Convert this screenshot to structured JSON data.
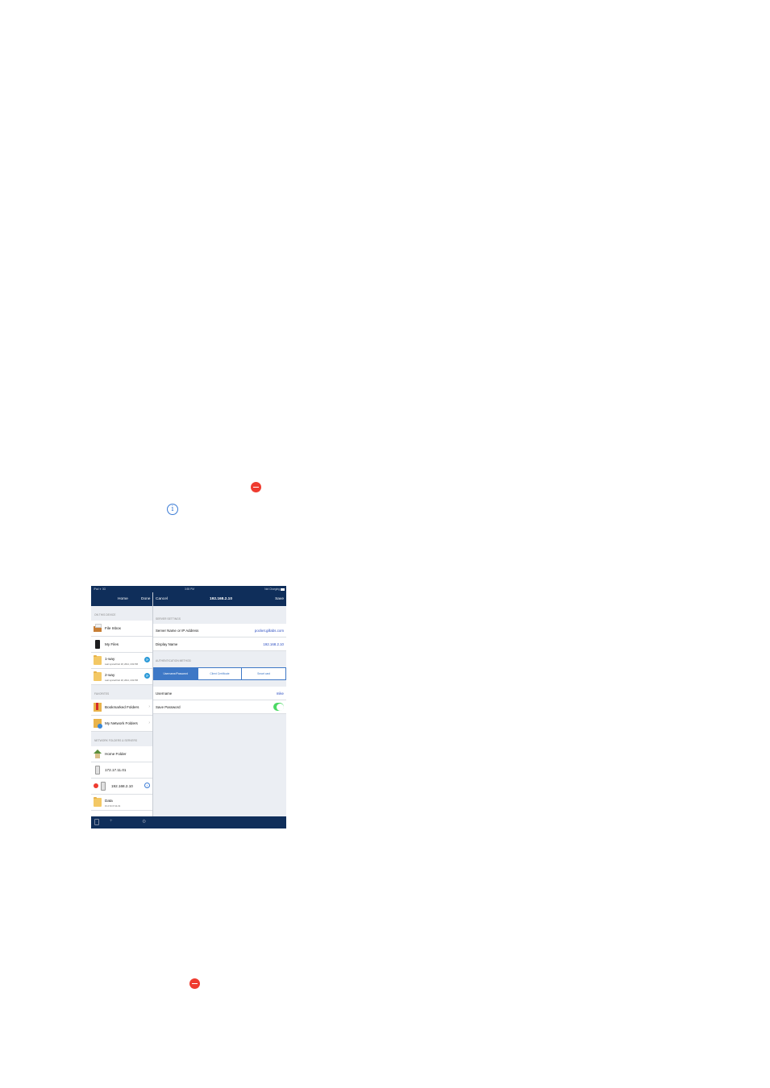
{
  "status_bar": {
    "left": "iPad ✈ 3G",
    "time": "3:55 PM",
    "right": "Not Charging"
  },
  "left_nav": {
    "title": "Home",
    "done": "Done"
  },
  "right_nav": {
    "cancel": "Cancel",
    "title": "192.168.2.10",
    "save": "Save"
  },
  "sections": {
    "on_device": "ON THIS DEVICE",
    "favorites": "FAVORITES",
    "network": "NETWORK FOLDERS & SERVERS"
  },
  "device_items": [
    {
      "label": "File Inbox",
      "icon": "inbox-icon"
    },
    {
      "label": "My Files",
      "icon": "ipad-icon"
    },
    {
      "label": "1-way",
      "sub": "Last synced Feb 18, 2014, 4:02 PM",
      "icon": "sync-folder-icon"
    },
    {
      "label": "2-way",
      "sub": "Last synced Feb 18, 2014, 4:02 PM",
      "icon": "sync-folder-icon"
    }
  ],
  "favorite_items": [
    {
      "label": "Bookmarked Folders",
      "icon": "bookmark-icon"
    },
    {
      "label": "My Network Folders",
      "icon": "network-folder-icon"
    }
  ],
  "network_items": [
    {
      "label": "Home Folder",
      "icon": "house-icon"
    },
    {
      "label": "172.17.11.01",
      "icon": "server-icon"
    },
    {
      "label": "192.168.2.10",
      "icon": "server-icon"
    },
    {
      "label": "Data",
      "sub": "On 172.17.11.01",
      "icon": "folder-icon"
    }
  ],
  "form": {
    "server_section": "SERVER SETTINGS",
    "server_label": "Server Name or IP Address",
    "server_value": "pocket.gillabs.com",
    "display_label": "Display Name",
    "display_value": "192.168.2.10",
    "auth_section": "AUTHENTICATION METHOD",
    "auth_options": [
      "Username/Password",
      "Client Certificate",
      "Smart card"
    ],
    "auth_selected": "Username/Password",
    "username_label": "Username",
    "username_value": "mike",
    "save_password_label": "Save Password",
    "save_password_on": true
  },
  "colors": {
    "nav_bar": "#0f2e5a",
    "accent": "#3e78c6",
    "toggle_on": "#4cd964",
    "delete_red": "#ef3b2f"
  }
}
